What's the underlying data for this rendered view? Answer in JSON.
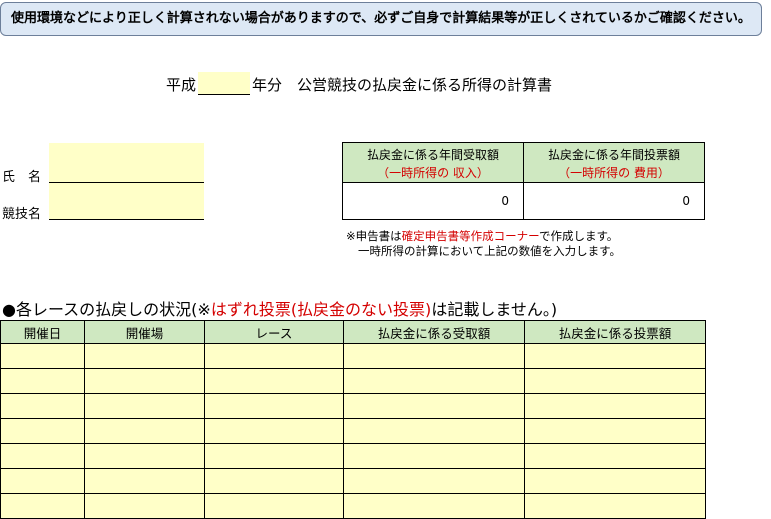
{
  "notice": "使用環境などにより正しく計算されない場合がありますので、必ずご自身で計算結果等が正しくされているかご確認ください。",
  "title": {
    "prefix": "平成",
    "year": "",
    "suffix": "年分　公営競技の払戻金に係る所得の計算書"
  },
  "fields": [
    {
      "label": "氏　名",
      "value": ""
    },
    {
      "label": "競技名",
      "value": ""
    }
  ],
  "summary": {
    "columns": [
      {
        "title": "払戻金に係る年間受取額",
        "subtitle": "（一時所得の 収入）",
        "value": "0"
      },
      {
        "title": "払戻金に係る年間投票額",
        "subtitle": "（一時所得の 費用）",
        "value": "0"
      }
    ]
  },
  "note": {
    "line1_a": "※申告書は",
    "line1_red": "確定申告書等作成コーナー",
    "line1_b": "で作成します。",
    "line2": "一時所得の計算において上記の数値を入力します。"
  },
  "section": {
    "a": "●各レースの払戻しの状況(※",
    "red": "はずれ投票(払戻金のない投票)",
    "b": "は記載しません。)"
  },
  "table": {
    "headers": [
      "開催日",
      "開催場",
      "レース",
      "払戻金に係る受取額",
      "払戻金に係る投票額"
    ],
    "row_count": 7
  },
  "colors": {
    "notice_bg": "#dde8f5",
    "input_yellow": "#ffffc8",
    "header_green": "#cfe8c1",
    "accent_red": "#d40000"
  }
}
